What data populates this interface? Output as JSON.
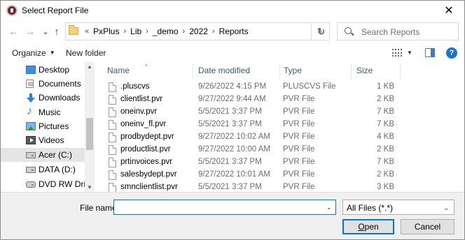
{
  "window": {
    "title": "Select Report File",
    "close_glyph": "✕"
  },
  "nav": {
    "back_glyph": "←",
    "forward_glyph": "→",
    "recent_glyph": "⌄",
    "up_glyph": "↑",
    "refresh_glyph": "↻"
  },
  "address": {
    "prefix": "«",
    "crumbs": [
      "PxPlus",
      "Lib",
      "_demo",
      "2022",
      "Reports"
    ],
    "separator": "›",
    "dropdown_glyph": "⌄"
  },
  "search": {
    "placeholder": "Search Reports"
  },
  "toolbar": {
    "organize": "Organize",
    "organize_caret": "▼",
    "new_folder": "New folder",
    "view_caret": "▼",
    "help": "?"
  },
  "sidebar": {
    "items": [
      {
        "label": "Desktop",
        "icon": "desktop-icon"
      },
      {
        "label": "Documents",
        "icon": "documents-icon"
      },
      {
        "label": "Downloads",
        "icon": "downloads-icon"
      },
      {
        "label": "Music",
        "icon": "music-icon"
      },
      {
        "label": "Pictures",
        "icon": "pictures-icon"
      },
      {
        "label": "Videos",
        "icon": "videos-icon"
      },
      {
        "label": "Acer (C:)",
        "icon": "drive-icon",
        "selected": true
      },
      {
        "label": "DATA (D:)",
        "icon": "drive-icon"
      },
      {
        "label": "DVD RW Drive",
        "icon": "dvd-drive-icon"
      }
    ],
    "scroll_up": "▲",
    "scroll_down": "▼"
  },
  "columns": {
    "name": "Name",
    "date": "Date modified",
    "type": "Type",
    "size": "Size",
    "sort_glyph": "^"
  },
  "files": [
    {
      "name": ".pluscvs",
      "date": "9/26/2022 4:15 PM",
      "type": "PLUSCVS File",
      "size": "1 KB"
    },
    {
      "name": "clientlist.pvr",
      "date": "9/27/2022 9:44 AM",
      "type": "PVR File",
      "size": "2 KB"
    },
    {
      "name": "oneinv.pvr",
      "date": "5/5/2021 3:37 PM",
      "type": "PVR File",
      "size": "7 KB"
    },
    {
      "name": "oneinv_fl.pvr",
      "date": "5/5/2021 3:37 PM",
      "type": "PVR File",
      "size": "7 KB"
    },
    {
      "name": "prodbydept.pvr",
      "date": "9/27/2022 10:02 AM",
      "type": "PVR File",
      "size": "4 KB"
    },
    {
      "name": "productlist.pvr",
      "date": "9/27/2022 10:00 AM",
      "type": "PVR File",
      "size": "2 KB"
    },
    {
      "name": "prtinvoices.pvr",
      "date": "5/5/2021 3:37 PM",
      "type": "PVR File",
      "size": "7 KB"
    },
    {
      "name": "salesbydept.pvr",
      "date": "9/27/2022 10:01 AM",
      "type": "PVR File",
      "size": "2 KB"
    },
    {
      "name": "smnclientlist.pvr",
      "date": "5/5/2021 3:37 PM",
      "type": "PVR File",
      "size": "3 KB"
    }
  ],
  "footer": {
    "filename_label": "File name:",
    "filename_value": "",
    "filename_caret": "⌄",
    "filetype": "All Files (*.*)",
    "filetype_caret": "⌄",
    "open": "Open",
    "cancel": "Cancel"
  }
}
